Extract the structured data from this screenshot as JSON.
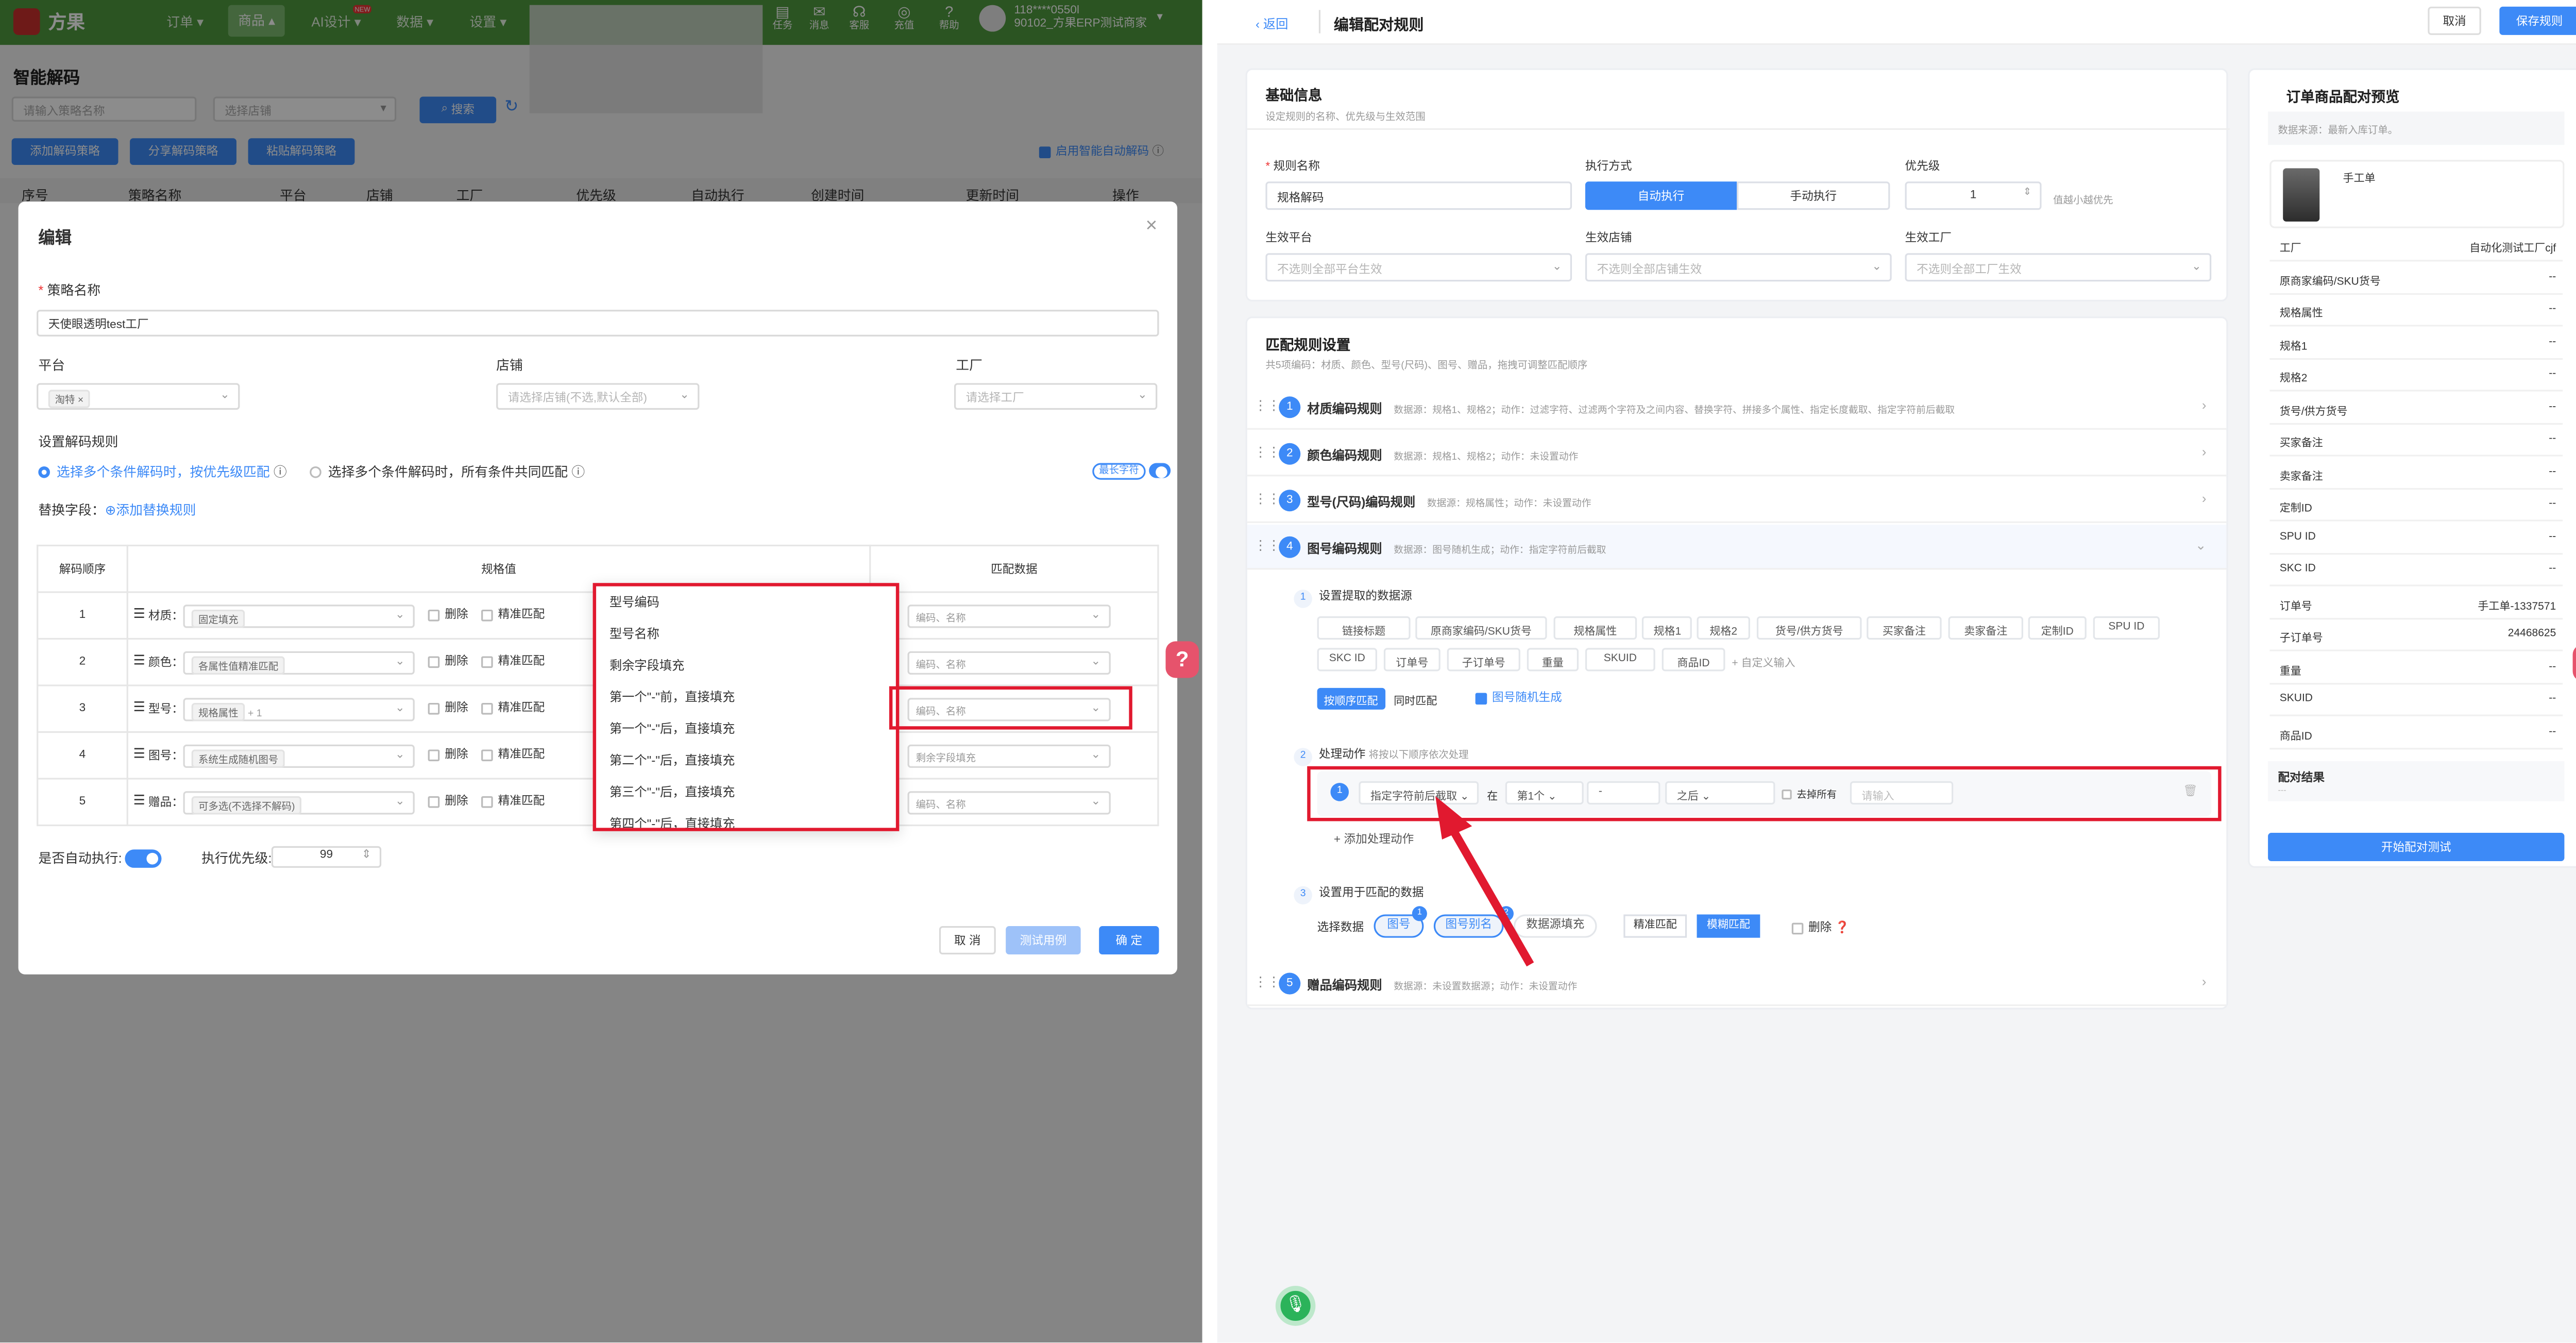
{
  "left_app": {
    "brand": "方果",
    "nav": [
      "订单",
      "商品",
      "AI设计",
      "数据",
      "设置"
    ],
    "nav_badge": "NEW",
    "nav_icons": [
      {
        "label": "任务",
        "icon": "task-icon"
      },
      {
        "label": "消息",
        "icon": "message-icon"
      },
      {
        "label": "客服",
        "icon": "headset-icon"
      },
      {
        "label": "充值",
        "icon": "coin-icon"
      },
      {
        "label": "帮助",
        "icon": "help-icon"
      }
    ],
    "account": {
      "phone": "118****0550l",
      "name": "90102_方果ERP测试商家"
    },
    "page_title": "智能解码",
    "search_placeholder": "请输入策略名称",
    "store_placeholder": "选择店铺",
    "search_btn": "搜索",
    "buttons": [
      "添加解码策略",
      "分享解码策略",
      "粘贴解码策略"
    ],
    "auto_decode": "启用智能自动解码",
    "columns": [
      "序号",
      "策略名称",
      "平台",
      "店铺",
      "工厂",
      "优先级",
      "自动执行",
      "创建时间",
      "更新时间",
      "操作"
    ]
  },
  "modal": {
    "title": "编辑",
    "strategy_label": "策略名称",
    "strategy_value": "天使眼透明test工厂",
    "platform_label": "平台",
    "platform_tag": "淘特",
    "store_label": "店铺",
    "store_placeholder": "请选择店铺(不选,默认全部)",
    "factory_label": "工厂",
    "factory_placeholder": "请选择工厂",
    "rule_label": "设置解码规则",
    "radio1": "选择多个条件解码时，按优先级匹配",
    "radio2": "选择多个条件解码时，所有条件共同匹配",
    "longest_label": "最长字符",
    "replace_label": "替换字段：",
    "add_replace": "添加替换规则",
    "table_headers": [
      "解码顺序",
      "规格值",
      "匹配数据"
    ],
    "rows": [
      {
        "order": "1",
        "name": "材质：",
        "tag": "固定填充",
        "extra": "",
        "match_ph": "编码、名称"
      },
      {
        "order": "2",
        "name": "颜色：",
        "tag": "各属性值精准匹配",
        "extra": "",
        "match_ph": "编码、名称"
      },
      {
        "order": "3",
        "name": "型号：",
        "tag": "规格属性",
        "extra": "+ 1",
        "match_ph": "编码、名称"
      },
      {
        "order": "4",
        "name": "图号：",
        "tag": "系统生成随机图号",
        "extra": "",
        "match_ph": "剩余字段填充"
      },
      {
        "order": "5",
        "name": "赠品：",
        "tag": "可多选(不选择不解码)",
        "extra": "",
        "match_ph": "编码、名称"
      }
    ],
    "delete_label": "删除",
    "exact_label": "精准匹配",
    "dropdown": [
      "型号编码",
      "型号名称",
      "剩余字段填充",
      "第一个\"-\"前，直接填充",
      "第一个\"-\"后，直接填充",
      "第二个\"-\"后，直接填充",
      "第三个\"-\"后，直接填充",
      "第四个\"-\"后，直接填充"
    ],
    "auto_exec_label": "是否自动执行",
    "priority_label": "执行优先级",
    "priority_value": "99",
    "cancel": "取 消",
    "test": "测试用例",
    "ok": "确 定"
  },
  "right_app": {
    "back": "返回",
    "title": "编辑配对规则",
    "cancel": "取消",
    "save": "保存规则",
    "basic": {
      "title": "基础信息",
      "subtitle": "设定规则的名称、优先级与生效范围",
      "name_label": "规则名称",
      "name_value": "规格解码",
      "mode_label": "执行方式",
      "mode_auto": "自动执行",
      "mode_manual": "手动执行",
      "priority_label": "优先级",
      "priority_value": "1",
      "priority_hint": "值越小越优先",
      "platform_label": "生效平台",
      "platform_ph": "不选则全部平台生效",
      "store_label": "生效店铺",
      "store_ph": "不选则全部店铺生效",
      "factory_label": "生效工厂",
      "factory_ph": "不选则全部工厂生效"
    },
    "match": {
      "title": "匹配规则设置",
      "subtitle": "共5项编码：材质、颜色、型号(尺码)、图号、赠品，拖拽可调整匹配顺序",
      "rules": [
        {
          "num": "1",
          "name": "材质编码规则",
          "desc": "数据源：规格1、规格2；动作：过滤字符、过滤两个字符及之间内容、替换字符、拼接多个属性、指定长度截取、指定字符前后截取"
        },
        {
          "num": "2",
          "name": "颜色编码规则",
          "desc": "数据源：规格1、规格2；动作：未设置动作"
        },
        {
          "num": "3",
          "name": "型号(尺码)编码规则",
          "desc": "数据源：规格属性；动作：未设置动作"
        },
        {
          "num": "4",
          "name": "图号编码规则",
          "desc": "数据源：图号随机生成；动作：指定字符前后截取"
        },
        {
          "num": "5",
          "name": "赠品编码规则",
          "desc": "数据源：未设置数据源；动作：未设置动作"
        }
      ],
      "step1": "设置提取的数据源",
      "sources": [
        "链接标题",
        "原商家编码/SKU货号",
        "规格属性",
        "规格1",
        "规格2",
        "货号/供方货号",
        "买家备注",
        "卖家备注",
        "定制ID",
        "SPU ID",
        "SKC ID",
        "订单号",
        "子订单号",
        "重量",
        "SKUID",
        "商品ID"
      ],
      "custom_input": "自定义输入",
      "seq_match": "按顺序匹配",
      "sim_match": "同时匹配",
      "random_gen": "图号随机生成",
      "step2": "处理动作",
      "step2_hint": "将按以下顺序依次处理",
      "action_type": "指定字符前后截取",
      "at": "在",
      "nth": "第1个",
      "char": "-",
      "after": "之后",
      "remove_all": "去掉所有",
      "input_ph": "请输入",
      "add_action": "添加处理动作",
      "step3": "设置用于匹配的数据",
      "select_data": "选择数据",
      "pills": [
        "图号",
        "图号别名"
      ],
      "pill_badges": [
        "1",
        "2"
      ],
      "source_fill": "数据源填充",
      "exact": "精准匹配",
      "fuzzy": "模糊匹配",
      "delete": "删除"
    },
    "preview": {
      "title": "订单商品配对预览",
      "source": "数据来源：最新入库订单。",
      "product": "手工单",
      "rows": [
        {
          "k": "工厂",
          "v": "自动化测试工厂cjf"
        },
        {
          "k": "原商家编码/SKU货号",
          "v": "--"
        },
        {
          "k": "规格属性",
          "v": "--"
        },
        {
          "k": "规格1",
          "v": "--"
        },
        {
          "k": "规格2",
          "v": "--"
        },
        {
          "k": "货号/供方货号",
          "v": "--"
        },
        {
          "k": "买家备注",
          "v": "--"
        },
        {
          "k": "卖家备注",
          "v": "--"
        },
        {
          "k": "定制ID",
          "v": "--"
        },
        {
          "k": "SPU ID",
          "v": "--"
        },
        {
          "k": "SKC ID",
          "v": "--"
        },
        {
          "k": "订单号",
          "v": "手工单-1337571"
        },
        {
          "k": "子订单号",
          "v": "24468625"
        },
        {
          "k": "重量",
          "v": "--"
        },
        {
          "k": "SKUID",
          "v": "--"
        },
        {
          "k": "商品ID",
          "v": "--"
        }
      ],
      "result_label": "配对结果",
      "result_value": "---",
      "test_btn": "开始配对测试"
    }
  },
  "colors": {
    "accent": "#3d8af7",
    "nav_green": "#4f9a3f",
    "highlight_red": "#e1192f",
    "help_pink": "#e6536c",
    "mic_green": "#2bb35a"
  }
}
